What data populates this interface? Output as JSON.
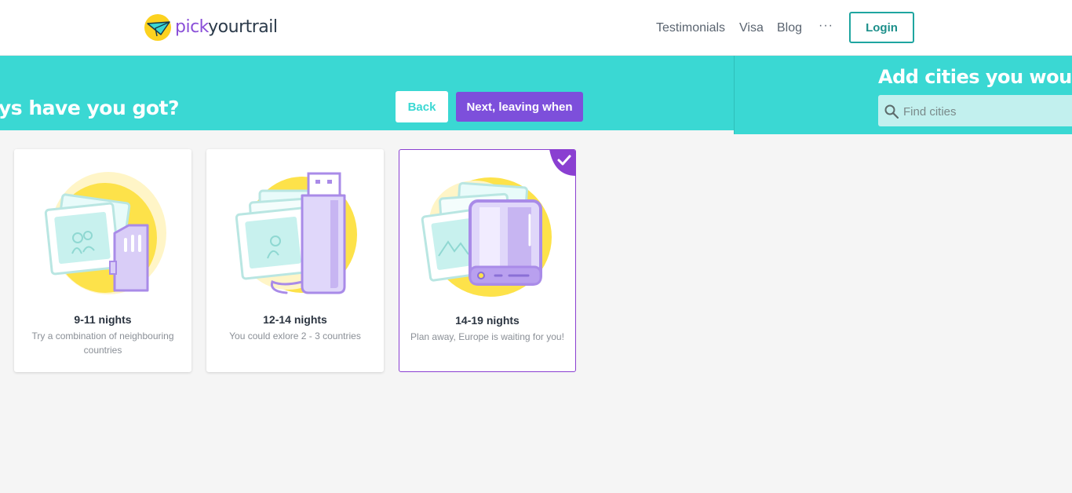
{
  "header": {
    "logo": {
      "pick": "pick",
      "rest": "yourtrail"
    },
    "nav": [
      "Testimonials",
      "Visa",
      "Blog"
    ],
    "more": "···",
    "login": "Login"
  },
  "step": {
    "question": "ys have you got?",
    "back": "Back",
    "next": "Next, leaving when"
  },
  "cities_panel": {
    "title": "Add cities you would",
    "search_placeholder": "Find cities"
  },
  "cards": [
    {
      "title": "9-11 nights",
      "desc": "Try a combination of neighbouring countries",
      "icon": "sd-card-photos-illustration",
      "selected": false
    },
    {
      "title": "12-14 nights",
      "desc": "You could exlore 2 - 3 countries",
      "icon": "usb-drive-photos-illustration",
      "selected": false
    },
    {
      "title": "14-19 nights",
      "desc": "Plan away, Europe is waiting for you!",
      "icon": "hard-drive-photos-illustration",
      "selected": true
    }
  ],
  "colors": {
    "teal": "#3ad8d3",
    "purple": "#7d4fdb",
    "yellow": "#fde24a",
    "lilac": "#d9cdf7"
  }
}
